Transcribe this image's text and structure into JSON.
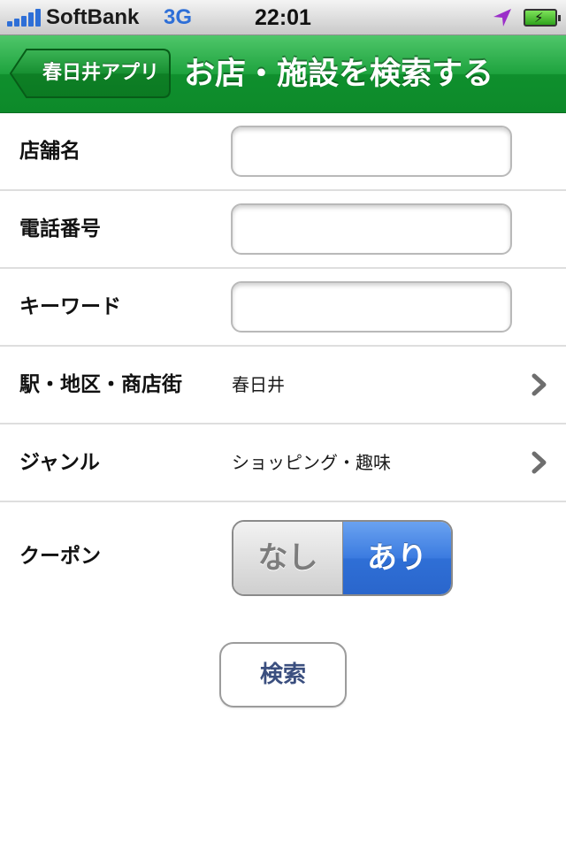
{
  "status_bar": {
    "carrier": "SoftBank",
    "network": "3G",
    "time": "22:01",
    "icons": [
      "signal-bars-icon",
      "location-arrow-icon",
      "battery-charging-icon"
    ]
  },
  "nav": {
    "back_label": "春日井アプリ",
    "title": "お店・施設を検索する"
  },
  "form": {
    "rows": [
      {
        "label": "店舗名",
        "type": "text",
        "value": ""
      },
      {
        "label": "電話番号",
        "type": "text",
        "value": ""
      },
      {
        "label": "キーワード",
        "type": "text",
        "value": ""
      },
      {
        "label": "駅・地区・商店街",
        "type": "select",
        "value": "春日井"
      },
      {
        "label": "ジャンル",
        "type": "select",
        "value": "ショッピング・趣味"
      },
      {
        "label": "クーポン",
        "type": "segmented"
      }
    ],
    "coupon": {
      "options": [
        "なし",
        "あり"
      ],
      "selected": "あり"
    },
    "search_button": "検索"
  },
  "colors": {
    "nav_green": "#1ea33e",
    "segment_blue": "#3b7be0",
    "button_text": "#3b4f7f"
  }
}
